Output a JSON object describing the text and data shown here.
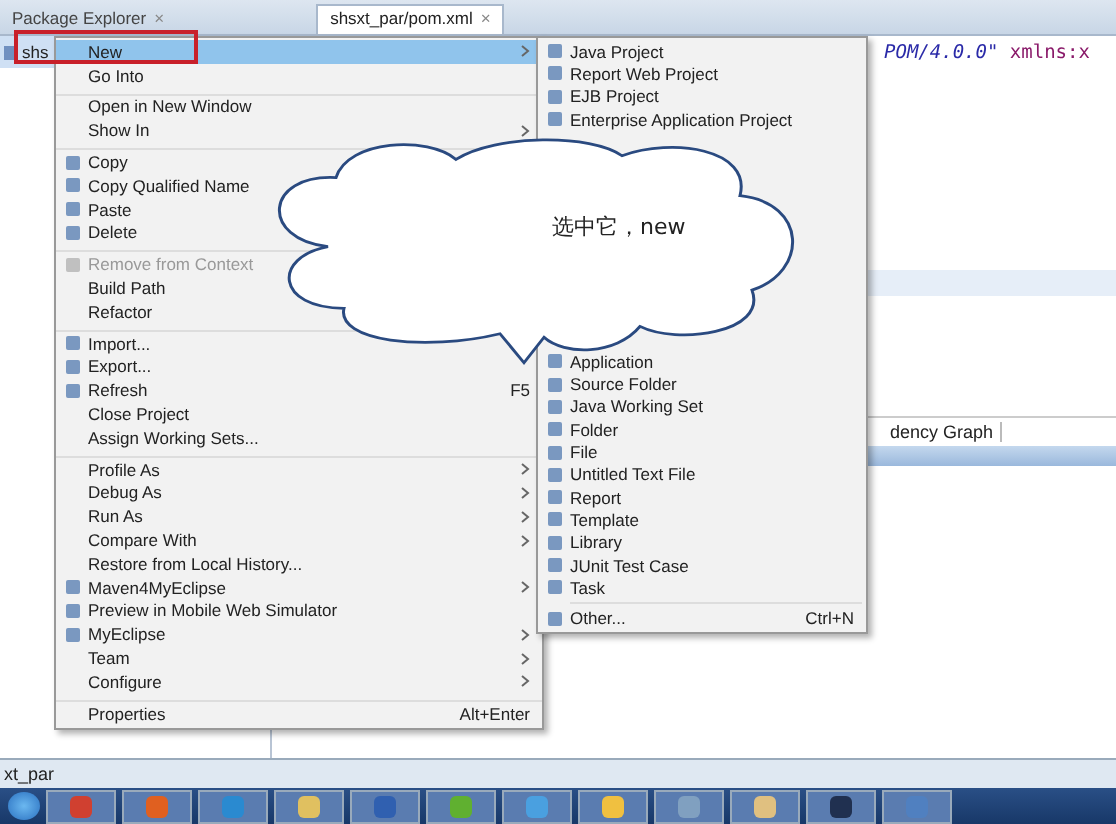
{
  "tabs": [
    {
      "label": "Package Explorer",
      "close": "×",
      "selected": false
    },
    {
      "label": "shsxt_par/pom.xml",
      "close": "×",
      "selected": true
    }
  ],
  "tree": {
    "items": [
      {
        "label": "shs",
        "selected": true
      }
    ]
  },
  "editor": {
    "code_parts": [
      {
        "text": "POM/4.0.0\"",
        "kind": "value"
      },
      {
        "text": " xmlns:x",
        "kind": "attr"
      }
    ],
    "bottom_tab": "dency Graph"
  },
  "context_menu": {
    "items": [
      {
        "label": "New",
        "icon": false,
        "submenu": true,
        "selected": true,
        "disabled": false,
        "separator_before": false
      },
      {
        "label": "Go Into",
        "icon": false,
        "submenu": false,
        "selected": false,
        "disabled": false,
        "separator_before": false
      },
      {
        "label": "Open in New Window",
        "icon": false,
        "submenu": false,
        "selected": false,
        "disabled": false,
        "separator_before": true
      },
      {
        "label": "Show In",
        "icon": false,
        "submenu": true,
        "selected": false,
        "disabled": false,
        "separator_before": false
      },
      {
        "label": "Copy",
        "icon": true,
        "submenu": false,
        "selected": false,
        "disabled": false,
        "separator_before": true
      },
      {
        "label": "Copy Qualified Name",
        "icon": true,
        "submenu": false,
        "selected": false,
        "disabled": false,
        "separator_before": false
      },
      {
        "label": "Paste",
        "icon": true,
        "submenu": false,
        "selected": false,
        "disabled": false,
        "separator_before": false
      },
      {
        "label": "Delete",
        "icon": true,
        "submenu": false,
        "selected": false,
        "disabled": false,
        "separator_before": false
      },
      {
        "label": "Remove from Context",
        "icon": true,
        "submenu": false,
        "selected": false,
        "disabled": true,
        "separator_before": true
      },
      {
        "label": "Build Path",
        "icon": false,
        "selected": false,
        "disabled": false,
        "separator_before": false
      },
      {
        "label": "Refactor",
        "icon": false,
        "selected": false,
        "disabled": false,
        "separator_before": false
      },
      {
        "label": "Import...",
        "icon": true,
        "submenu": false,
        "selected": false,
        "disabled": false,
        "separator_before": true
      },
      {
        "label": "Export...",
        "icon": true,
        "submenu": false,
        "selected": false,
        "disabled": false,
        "separator_before": false
      },
      {
        "label": "Refresh",
        "icon": true,
        "shortcut": "F5",
        "submenu": false,
        "selected": false,
        "disabled": false,
        "separator_before": false
      },
      {
        "label": "Close Project",
        "icon": false,
        "submenu": false,
        "selected": false,
        "disabled": false,
        "separator_before": false
      },
      {
        "label": "Assign Working Sets...",
        "icon": false,
        "submenu": false,
        "selected": false,
        "disabled": false,
        "separator_before": false
      },
      {
        "label": "Profile As",
        "icon": false,
        "submenu": true,
        "selected": false,
        "disabled": false,
        "separator_before": true
      },
      {
        "label": "Debug As",
        "icon": false,
        "submenu": true,
        "selected": false,
        "disabled": false,
        "separator_before": false
      },
      {
        "label": "Run As",
        "icon": false,
        "submenu": true,
        "selected": false,
        "disabled": false,
        "separator_before": false
      },
      {
        "label": "Compare With",
        "icon": false,
        "submenu": true,
        "selected": false,
        "disabled": false,
        "separator_before": false
      },
      {
        "label": "Restore from Local History...",
        "icon": false,
        "submenu": false,
        "selected": false,
        "disabled": false,
        "separator_before": false
      },
      {
        "label": "Maven4MyEclipse",
        "icon": true,
        "submenu": true,
        "selected": false,
        "disabled": false,
        "separator_before": false
      },
      {
        "label": "Preview in Mobile Web Simulator",
        "icon": true,
        "submenu": false,
        "selected": false,
        "disabled": false,
        "separator_before": false
      },
      {
        "label": "MyEclipse",
        "icon": true,
        "submenu": true,
        "selected": false,
        "disabled": false,
        "separator_before": false
      },
      {
        "label": "Team",
        "icon": false,
        "submenu": true,
        "selected": false,
        "disabled": false,
        "separator_before": false
      },
      {
        "label": "Configure",
        "icon": false,
        "submenu": true,
        "selected": false,
        "disabled": false,
        "separator_before": false
      },
      {
        "label": "Properties",
        "icon": false,
        "shortcut": "Alt+Enter",
        "submenu": false,
        "selected": false,
        "disabled": false,
        "separator_before": true
      }
    ]
  },
  "new_submenu": {
    "items_top": [
      "Java Project",
      "Report Web Project",
      "EJB Project",
      "Enterprise Application Project"
    ],
    "items_bottom": [
      "Application",
      "Source Folder",
      "Java Working Set",
      "Folder",
      "File",
      "Untitled Text File",
      "Report",
      "Template",
      "Library",
      "JUnit Test Case",
      "Task"
    ],
    "other": {
      "label": "Other...",
      "shortcut": "Ctrl+N"
    }
  },
  "callout": {
    "text": "选中它，new"
  },
  "status_bar": {
    "text": "xt_par"
  }
}
